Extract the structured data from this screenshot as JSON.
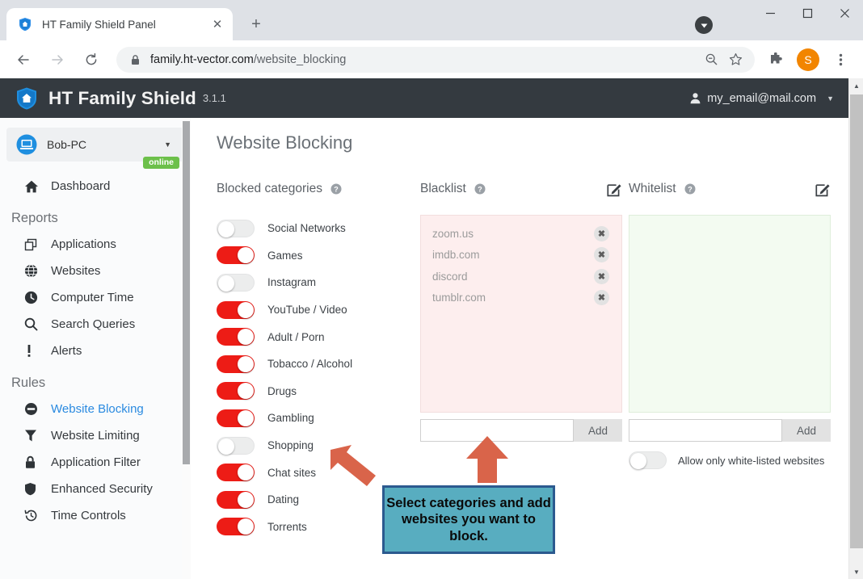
{
  "browser": {
    "tab": {
      "title": "HT Family Shield Panel",
      "favicon": "shield-home-icon",
      "close": "✕"
    },
    "new_tab_label": "+",
    "window_controls": {
      "minimize": "—",
      "maximize": "□",
      "close": "✕"
    },
    "nav": {
      "back": "←",
      "forward": "→",
      "reload": "↻"
    },
    "omnibox": {
      "lock_icon": "lock-icon",
      "url_host": "family.ht-vector.com",
      "url_path": "/website_blocking",
      "zoom_icon": "zoom-out-icon",
      "bookmark_icon": "star-icon"
    },
    "toolbar": {
      "extensions_icon": "puzzle-icon",
      "profile_initial": "S",
      "menu_icon": "kebab-menu-icon"
    }
  },
  "app": {
    "brand": "HT Family Shield",
    "version": "3.1.1",
    "account_email": "my_email@mail.com"
  },
  "sidebar": {
    "device": {
      "name": "Bob-PC",
      "status": "online"
    },
    "top_items": [
      {
        "label": "Dashboard",
        "icon": "home-icon",
        "active": false
      }
    ],
    "sections": [
      {
        "title": "Reports",
        "items": [
          {
            "label": "Applications",
            "icon": "windows-stack-icon",
            "active": false
          },
          {
            "label": "Websites",
            "icon": "globe-icon",
            "active": false
          },
          {
            "label": "Computer Time",
            "icon": "clock-icon",
            "active": false
          },
          {
            "label": "Search Queries",
            "icon": "search-icon",
            "active": false
          },
          {
            "label": "Alerts",
            "icon": "exclamation-icon",
            "active": false
          }
        ]
      },
      {
        "title": "Rules",
        "items": [
          {
            "label": "Website Blocking",
            "icon": "block-icon",
            "active": true
          },
          {
            "label": "Website Limiting",
            "icon": "funnel-icon",
            "active": false
          },
          {
            "label": "Application Filter",
            "icon": "lock-icon",
            "active": false
          },
          {
            "label": "Enhanced Security",
            "icon": "shield-icon",
            "active": false
          },
          {
            "label": "Time Controls",
            "icon": "history-icon",
            "active": false
          }
        ]
      }
    ]
  },
  "main": {
    "page_title": "Website Blocking",
    "categories_panel": {
      "title": "Blocked categories",
      "help_icon": "help-circle-icon",
      "items": [
        {
          "label": "Social Networks",
          "on": false
        },
        {
          "label": "Games",
          "on": true
        },
        {
          "label": "Instagram",
          "on": false
        },
        {
          "label": "YouTube / Video",
          "on": true
        },
        {
          "label": "Adult / Porn",
          "on": true
        },
        {
          "label": "Tobacco / Alcohol",
          "on": true
        },
        {
          "label": "Drugs",
          "on": true
        },
        {
          "label": "Gambling",
          "on": true
        },
        {
          "label": "Shopping",
          "on": false
        },
        {
          "label": "Chat sites",
          "on": true
        },
        {
          "label": "Dating",
          "on": true
        },
        {
          "label": "Torrents",
          "on": true
        }
      ]
    },
    "blacklist": {
      "title": "Blacklist",
      "help_icon": "help-circle-icon",
      "edit_icon": "edit-pencil-icon",
      "entries": [
        "zoom.us",
        "imdb.com",
        "discord",
        "tumblr.com"
      ],
      "remove_glyph": "✖",
      "input_value": "",
      "input_placeholder": "",
      "add_label": "Add"
    },
    "whitelist": {
      "title": "Whitelist",
      "help_icon": "help-circle-icon",
      "edit_icon": "edit-pencil-icon",
      "entries": [],
      "input_value": "",
      "input_placeholder": "",
      "add_label": "Add",
      "allow_only_toggle": {
        "label": "Allow only white-listed websites",
        "on": false
      }
    }
  },
  "annotations": {
    "callout_text": "Select categories and add websites you want to block.",
    "callout_bg": "#58adc0",
    "callout_border": "#2c5a8f",
    "arrow_color": "#d9644a"
  },
  "colors": {
    "appbar_bg": "#343a40",
    "toggle_on": "#ed1c16",
    "toggle_off": "#eceded",
    "active_nav": "#2a8ae0",
    "online_badge": "#6cc04a",
    "blacklist_bg": "#fdeeee",
    "whitelist_bg": "#f3fbf1",
    "profile_avatar": "#f28500"
  }
}
